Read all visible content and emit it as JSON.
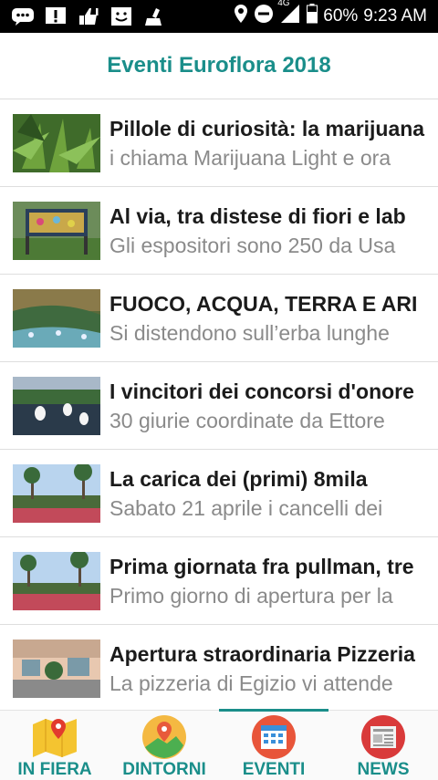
{
  "status": {
    "network": "4G",
    "battery": "60%",
    "time": "9:23 AM"
  },
  "header": {
    "title": "Eventi Euroflora 2018"
  },
  "articles": [
    {
      "title": "Pillole di curiosità: la marijuana",
      "subtitle": "i chiama Marijuana Light e ora",
      "thumb": "cannabis-plant"
    },
    {
      "title": "Al via, tra distese di fiori e lab",
      "subtitle": "Gli espositori sono 250 da Usa",
      "thumb": "flower-display"
    },
    {
      "title": "FUOCO, ACQUA, TERRA E ARI",
      "subtitle": "Si distendono sull’erba lunghe",
      "thumb": "garden-water"
    },
    {
      "title": "I vincitori dei concorsi d'onore",
      "subtitle": "30 giurie coordinate da Ettore",
      "thumb": "pond-lilies"
    },
    {
      "title": "La carica dei (primi) 8mila",
      "subtitle": "Sabato 21 aprile i cancelli dei",
      "thumb": "park-flowerbeds"
    },
    {
      "title": "Prima giornata fra pullman, tre",
      "subtitle": "Primo giorno di apertura per la",
      "thumb": "park-flowerbeds"
    },
    {
      "title": "Apertura straordinaria Pizzeria",
      "subtitle": "La pizzeria di Egizio vi attende",
      "thumb": "pizzeria-terrace"
    }
  ],
  "nav": [
    {
      "label": "IN FIERA",
      "icon": "map-pin-icon",
      "active": false
    },
    {
      "label": "DINTORNI",
      "icon": "location-pin-icon",
      "active": false
    },
    {
      "label": "EVENTI",
      "icon": "calendar-icon",
      "active": true
    },
    {
      "label": "NEWS",
      "icon": "newspaper-icon",
      "active": false
    }
  ],
  "colors": {
    "accent": "#1a8e8a",
    "statusbar": "#000000",
    "subtitle": "#8a8a8a"
  }
}
